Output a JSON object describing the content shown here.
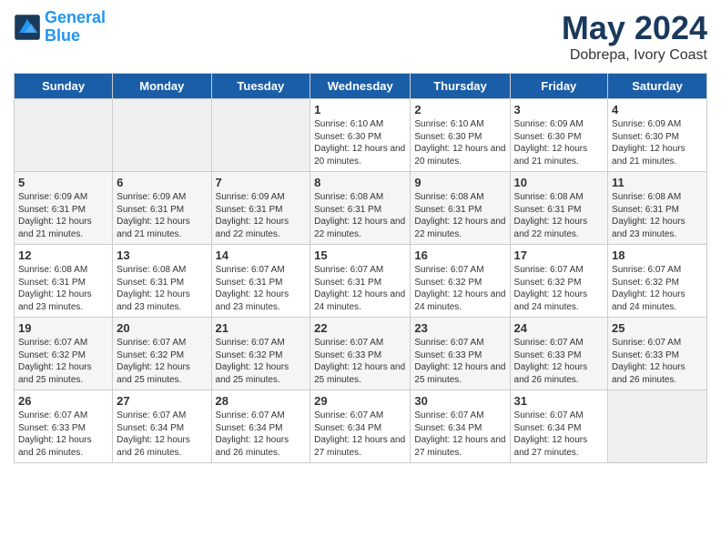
{
  "header": {
    "logo_line1": "General",
    "logo_line2": "Blue",
    "month": "May 2024",
    "location": "Dobrepa, Ivory Coast"
  },
  "weekdays": [
    "Sunday",
    "Monday",
    "Tuesday",
    "Wednesday",
    "Thursday",
    "Friday",
    "Saturday"
  ],
  "weeks": [
    [
      {
        "day": "",
        "info": ""
      },
      {
        "day": "",
        "info": ""
      },
      {
        "day": "",
        "info": ""
      },
      {
        "day": "1",
        "info": "Sunrise: 6:10 AM\nSunset: 6:30 PM\nDaylight: 12 hours and 20 minutes."
      },
      {
        "day": "2",
        "info": "Sunrise: 6:10 AM\nSunset: 6:30 PM\nDaylight: 12 hours and 20 minutes."
      },
      {
        "day": "3",
        "info": "Sunrise: 6:09 AM\nSunset: 6:30 PM\nDaylight: 12 hours and 21 minutes."
      },
      {
        "day": "4",
        "info": "Sunrise: 6:09 AM\nSunset: 6:30 PM\nDaylight: 12 hours and 21 minutes."
      }
    ],
    [
      {
        "day": "5",
        "info": "Sunrise: 6:09 AM\nSunset: 6:31 PM\nDaylight: 12 hours and 21 minutes."
      },
      {
        "day": "6",
        "info": "Sunrise: 6:09 AM\nSunset: 6:31 PM\nDaylight: 12 hours and 21 minutes."
      },
      {
        "day": "7",
        "info": "Sunrise: 6:09 AM\nSunset: 6:31 PM\nDaylight: 12 hours and 22 minutes."
      },
      {
        "day": "8",
        "info": "Sunrise: 6:08 AM\nSunset: 6:31 PM\nDaylight: 12 hours and 22 minutes."
      },
      {
        "day": "9",
        "info": "Sunrise: 6:08 AM\nSunset: 6:31 PM\nDaylight: 12 hours and 22 minutes."
      },
      {
        "day": "10",
        "info": "Sunrise: 6:08 AM\nSunset: 6:31 PM\nDaylight: 12 hours and 22 minutes."
      },
      {
        "day": "11",
        "info": "Sunrise: 6:08 AM\nSunset: 6:31 PM\nDaylight: 12 hours and 23 minutes."
      }
    ],
    [
      {
        "day": "12",
        "info": "Sunrise: 6:08 AM\nSunset: 6:31 PM\nDaylight: 12 hours and 23 minutes."
      },
      {
        "day": "13",
        "info": "Sunrise: 6:08 AM\nSunset: 6:31 PM\nDaylight: 12 hours and 23 minutes."
      },
      {
        "day": "14",
        "info": "Sunrise: 6:07 AM\nSunset: 6:31 PM\nDaylight: 12 hours and 23 minutes."
      },
      {
        "day": "15",
        "info": "Sunrise: 6:07 AM\nSunset: 6:31 PM\nDaylight: 12 hours and 24 minutes."
      },
      {
        "day": "16",
        "info": "Sunrise: 6:07 AM\nSunset: 6:32 PM\nDaylight: 12 hours and 24 minutes."
      },
      {
        "day": "17",
        "info": "Sunrise: 6:07 AM\nSunset: 6:32 PM\nDaylight: 12 hours and 24 minutes."
      },
      {
        "day": "18",
        "info": "Sunrise: 6:07 AM\nSunset: 6:32 PM\nDaylight: 12 hours and 24 minutes."
      }
    ],
    [
      {
        "day": "19",
        "info": "Sunrise: 6:07 AM\nSunset: 6:32 PM\nDaylight: 12 hours and 25 minutes."
      },
      {
        "day": "20",
        "info": "Sunrise: 6:07 AM\nSunset: 6:32 PM\nDaylight: 12 hours and 25 minutes."
      },
      {
        "day": "21",
        "info": "Sunrise: 6:07 AM\nSunset: 6:32 PM\nDaylight: 12 hours and 25 minutes."
      },
      {
        "day": "22",
        "info": "Sunrise: 6:07 AM\nSunset: 6:33 PM\nDaylight: 12 hours and 25 minutes."
      },
      {
        "day": "23",
        "info": "Sunrise: 6:07 AM\nSunset: 6:33 PM\nDaylight: 12 hours and 25 minutes."
      },
      {
        "day": "24",
        "info": "Sunrise: 6:07 AM\nSunset: 6:33 PM\nDaylight: 12 hours and 26 minutes."
      },
      {
        "day": "25",
        "info": "Sunrise: 6:07 AM\nSunset: 6:33 PM\nDaylight: 12 hours and 26 minutes."
      }
    ],
    [
      {
        "day": "26",
        "info": "Sunrise: 6:07 AM\nSunset: 6:33 PM\nDaylight: 12 hours and 26 minutes."
      },
      {
        "day": "27",
        "info": "Sunrise: 6:07 AM\nSunset: 6:34 PM\nDaylight: 12 hours and 26 minutes."
      },
      {
        "day": "28",
        "info": "Sunrise: 6:07 AM\nSunset: 6:34 PM\nDaylight: 12 hours and 26 minutes."
      },
      {
        "day": "29",
        "info": "Sunrise: 6:07 AM\nSunset: 6:34 PM\nDaylight: 12 hours and 27 minutes."
      },
      {
        "day": "30",
        "info": "Sunrise: 6:07 AM\nSunset: 6:34 PM\nDaylight: 12 hours and 27 minutes."
      },
      {
        "day": "31",
        "info": "Sunrise: 6:07 AM\nSunset: 6:34 PM\nDaylight: 12 hours and 27 minutes."
      },
      {
        "day": "",
        "info": ""
      }
    ]
  ]
}
